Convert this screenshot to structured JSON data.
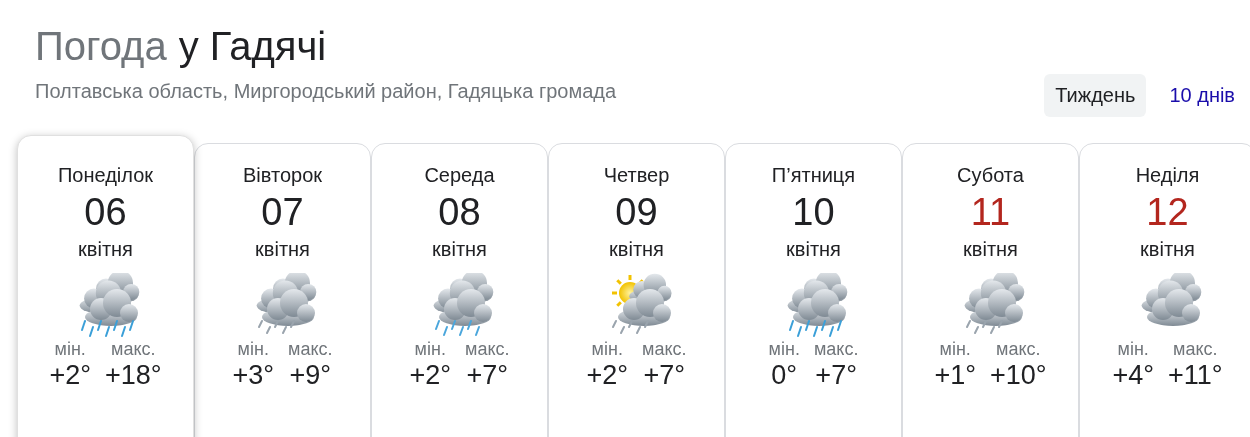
{
  "title": {
    "prefix": "Погода",
    "place": "у Гадячі"
  },
  "subtitle": "Полтавська область, Миргородський район, Гадяцька громада",
  "tabs": [
    {
      "label": "Тиждень",
      "selected": true
    },
    {
      "label": "10 днів",
      "selected": false
    }
  ],
  "days": [
    {
      "weekday": "Понеділок",
      "date": "06",
      "month": "квітня",
      "weekend": false,
      "selected": true,
      "kind": "heavy-rain",
      "min_label": "мін.",
      "min": "+2°",
      "max_label": "макс.",
      "max": "+18°"
    },
    {
      "weekday": "Вівторок",
      "date": "07",
      "month": "квітня",
      "weekend": false,
      "selected": false,
      "kind": "light-rain",
      "min_label": "мін.",
      "min": "+3°",
      "max_label": "макс.",
      "max": "+9°"
    },
    {
      "weekday": "Середа",
      "date": "08",
      "month": "квітня",
      "weekend": false,
      "selected": false,
      "kind": "rain",
      "min_label": "мін.",
      "min": "+2°",
      "max_label": "макс.",
      "max": "+7°"
    },
    {
      "weekday": "Четвер",
      "date": "09",
      "month": "квітня",
      "weekend": false,
      "selected": false,
      "kind": "sun-rain",
      "min_label": "мін.",
      "min": "+2°",
      "max_label": "макс.",
      "max": "+7°"
    },
    {
      "weekday": "П’ятниця",
      "date": "10",
      "month": "квітня",
      "weekend": false,
      "selected": false,
      "kind": "heavy-rain",
      "min_label": "мін.",
      "min": "0°",
      "max_label": "макс.",
      "max": "+7°"
    },
    {
      "weekday": "Субота",
      "date": "11",
      "month": "квітня",
      "weekend": true,
      "selected": false,
      "kind": "light-rain",
      "min_label": "мін.",
      "min": "+1°",
      "max_label": "макс.",
      "max": "+10°"
    },
    {
      "weekday": "Неділя",
      "date": "12",
      "month": "квітня",
      "weekend": true,
      "selected": false,
      "kind": "cloudy",
      "min_label": "мін.",
      "min": "+4°",
      "max_label": "макс.",
      "max": "+11°"
    }
  ]
}
